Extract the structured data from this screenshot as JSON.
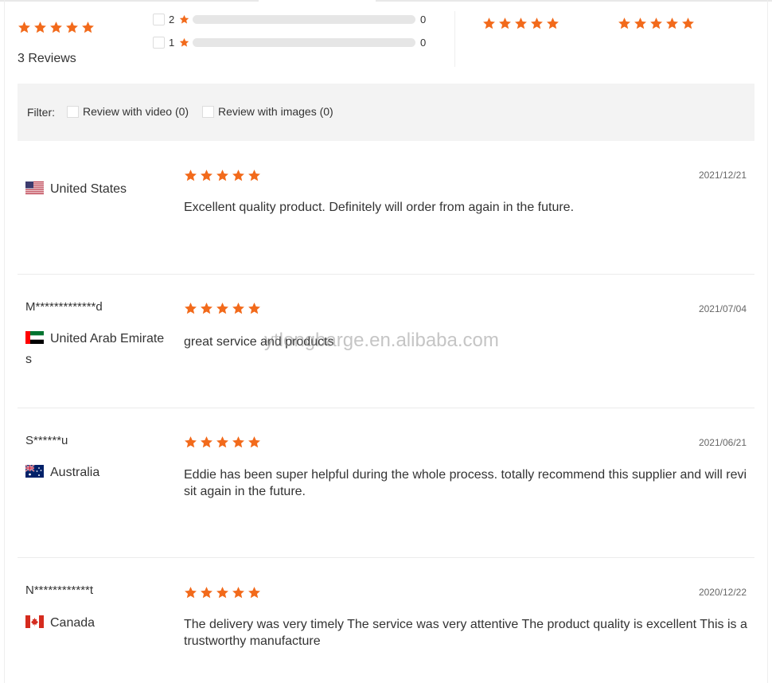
{
  "colors": {
    "star": "#f26a1b",
    "track": "#e6e6e6",
    "filter_bg": "#f3f3f3"
  },
  "summary": {
    "overall_rating": 5,
    "review_count_label": "3 Reviews",
    "breakdown": [
      {
        "stars": "2",
        "count": "0",
        "fraction": 0
      },
      {
        "stars": "1",
        "count": "0",
        "fraction": 0
      }
    ],
    "sub_ratings": [
      5,
      5
    ]
  },
  "filter": {
    "label": "Filter:",
    "video_label": "Review with video (0)",
    "images_label": "Review with images (0)"
  },
  "reviews": [
    {
      "user": "",
      "country": "United States",
      "flag": "us-flag-icon",
      "rating": 5,
      "date": "2021/12/21",
      "text": "Excellent quality product. Definitely will order from again in the future."
    },
    {
      "user": "M*************d",
      "country": "United Arab Emirates",
      "flag": "uae-flag-icon",
      "rating": 5,
      "date": "2021/07/04",
      "text": "great service and products"
    },
    {
      "user": "S******u",
      "country": "Australia",
      "flag": "australia-flag-icon",
      "rating": 5,
      "date": "2021/06/21",
      "text": "Eddie has been super helpful during the whole process. totally recommend this supplier and will revisit again in the future."
    },
    {
      "user": "N************t",
      "country": "Canada",
      "flag": "canada-flag-icon",
      "rating": 5,
      "date": "2020/12/22",
      "text": "The delivery was very timely The service was very attentive The product quality is excellent    This is a trustworthy manufacture"
    }
  ],
  "watermark": "ytlongbarge.en.alibaba.com"
}
